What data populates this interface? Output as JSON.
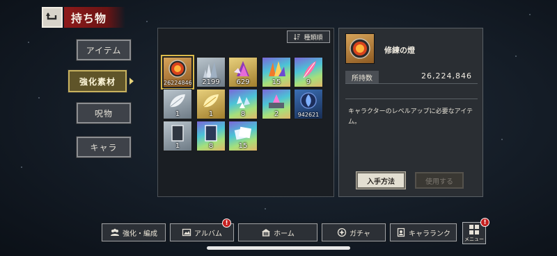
{
  "header": {
    "title": "持ち物",
    "back_icon": "back-arrow-icon"
  },
  "categories": [
    {
      "label": "アイテム",
      "active": false
    },
    {
      "label": "強化素材",
      "active": true
    },
    {
      "label": "呪物",
      "active": false
    },
    {
      "label": "キャラ",
      "active": false
    }
  ],
  "sort": {
    "label": "種類順",
    "icon": "sort-icon"
  },
  "items": [
    {
      "name": "修練の燈",
      "count": "26224846",
      "rarity": "orange",
      "icon": "flame-orb-icon",
      "selected": true
    },
    {
      "name": "silver-crystal",
      "count": "2199",
      "rarity": "silver",
      "icon": "crystal-cluster-icon"
    },
    {
      "name": "gold-crystal",
      "count": "629",
      "rarity": "gold",
      "icon": "crystal-cluster-icon"
    },
    {
      "name": "rainbow-crystal",
      "count": "15",
      "rarity": "rainbow",
      "icon": "crystal-cluster-icon"
    },
    {
      "name": "rainbow-feather",
      "count": "9",
      "rarity": "rainbow",
      "icon": "feather-icon"
    },
    {
      "name": "silver-leaf",
      "count": "1",
      "rarity": "silver",
      "icon": "leaf-icon"
    },
    {
      "name": "gold-leaf",
      "count": "1",
      "rarity": "gold",
      "icon": "leaf-icon"
    },
    {
      "name": "rainbow-shards",
      "count": "8",
      "rarity": "rainbow",
      "icon": "shards-icon"
    },
    {
      "name": "rainbow-altar",
      "count": "2",
      "rarity": "rainbow",
      "icon": "altar-icon"
    },
    {
      "name": "blue-orb",
      "count": "942621",
      "rarity": "blue",
      "icon": "blue-flame-icon"
    },
    {
      "name": "silver-mirror",
      "count": "1",
      "rarity": "silver",
      "icon": "mirror-icon"
    },
    {
      "name": "rainbow-mirror",
      "count": "8",
      "rarity": "rainbow",
      "icon": "mirror-icon"
    },
    {
      "name": "rainbow-pages",
      "count": "15",
      "rarity": "rainbow",
      "icon": "pages-icon"
    }
  ],
  "detail": {
    "name": "修練の燈",
    "qty_label": "所持数",
    "qty_value": "26,224,846",
    "description": "キャラクターのレベルアップに必要なアイテム。",
    "obtain_label": "入手方法",
    "use_label": "使用する"
  },
  "nav": [
    {
      "label": "強化・編成",
      "icon": "team-icon",
      "badge": false
    },
    {
      "label": "アルバム",
      "icon": "album-icon",
      "badge": true
    },
    {
      "label": "ホーム",
      "icon": "home-icon",
      "badge": false
    },
    {
      "label": "ガチャ",
      "icon": "gacha-icon",
      "badge": false
    },
    {
      "label": "キャラランク",
      "icon": "rank-icon",
      "badge": false
    }
  ],
  "menu": {
    "label": "メニュー",
    "badge": true
  },
  "badge_text": "!",
  "colors": {
    "accent_red": "#8d1a1a",
    "selected_gold": "#d9b94a",
    "badge_red": "#c42020"
  }
}
